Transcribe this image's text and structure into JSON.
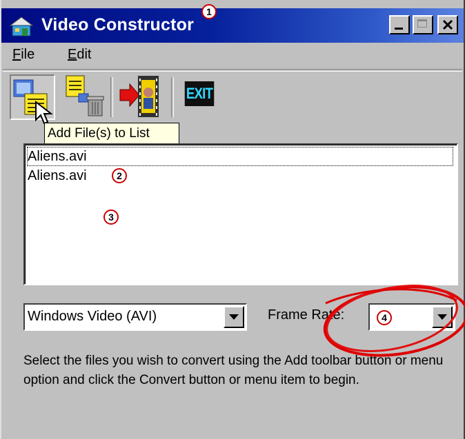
{
  "window": {
    "title": "Video Constructor"
  },
  "menubar": {
    "items": [
      {
        "label_u": "F",
        "label_rest": "ile"
      },
      {
        "label_u": "E",
        "label_rest": "dit"
      }
    ]
  },
  "toolbar": {
    "buttons": [
      {
        "name": "add-files",
        "icon": "add-files-icon",
        "state": "pressed"
      },
      {
        "name": "remove-files",
        "icon": "trash-icon"
      },
      {
        "name": "convert",
        "icon": "film-convert-icon"
      },
      {
        "name": "exit",
        "icon": "exit-icon",
        "label": "EXIT"
      }
    ],
    "tooltip": "Add File(s) to List"
  },
  "file_list": {
    "items": [
      "Aliens.avi",
      "Aliens.avi"
    ]
  },
  "format_select": {
    "selected": "Windows Video (AVI)"
  },
  "frame_rate": {
    "label": "Frame Rate:",
    "selected": ""
  },
  "hint_text": "Select the files you wish to convert using the Add toolbar button or menu option and click the Convert button or menu item to begin.",
  "annotations": {
    "c1": "1",
    "c2": "2",
    "c3": "3",
    "c4": "4"
  },
  "colors": {
    "titlebar_start": "#000a82",
    "titlebar_end": "#5c82e0",
    "face": "#c0c0c0",
    "markup_red": "#dd0000"
  }
}
